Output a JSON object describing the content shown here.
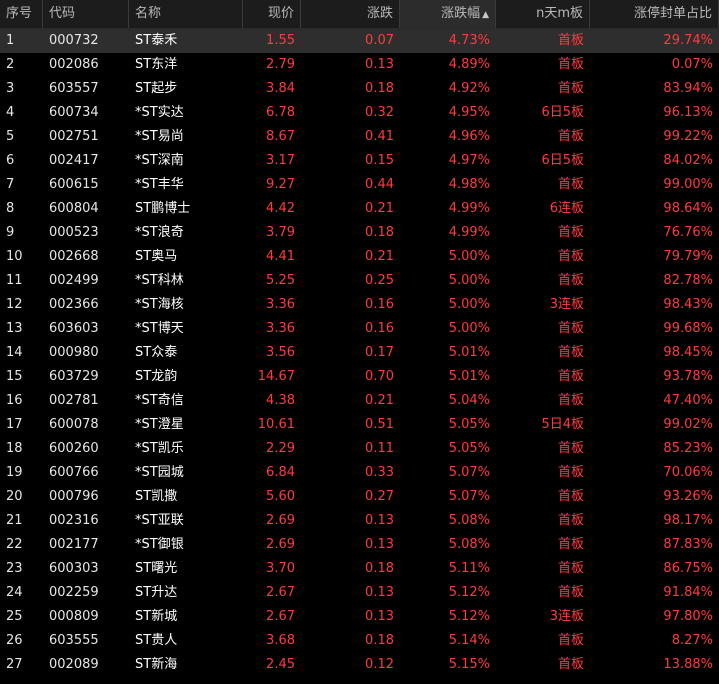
{
  "header": {
    "cols": [
      "序号",
      "代码",
      "名称",
      "现价",
      "涨跌",
      "涨跌幅",
      "n天m板",
      "涨停封单占比"
    ],
    "sort_indicator": "▲"
  },
  "colors": {
    "background": "#000000",
    "header_bg": "#1c1c1c",
    "selected_row_bg": "#2e2e2e",
    "up_red": "#ff3b3b",
    "text_white": "#e6e6e6"
  },
  "rows": [
    {
      "idx": "1",
      "code": "000732",
      "name": "ST泰禾",
      "price": "1.55",
      "change": "0.07",
      "pct": "4.73%",
      "board": "首板",
      "ratio": "29.74%"
    },
    {
      "idx": "2",
      "code": "002086",
      "name": "ST东洋",
      "price": "2.79",
      "change": "0.13",
      "pct": "4.89%",
      "board": "首板",
      "ratio": "0.07%"
    },
    {
      "idx": "3",
      "code": "603557",
      "name": "ST起步",
      "price": "3.84",
      "change": "0.18",
      "pct": "4.92%",
      "board": "首板",
      "ratio": "83.94%"
    },
    {
      "idx": "4",
      "code": "600734",
      "name": "*ST实达",
      "price": "6.78",
      "change": "0.32",
      "pct": "4.95%",
      "board": "6日5板",
      "ratio": "96.13%"
    },
    {
      "idx": "5",
      "code": "002751",
      "name": "*ST易尚",
      "price": "8.67",
      "change": "0.41",
      "pct": "4.96%",
      "board": "首板",
      "ratio": "99.22%"
    },
    {
      "idx": "6",
      "code": "002417",
      "name": "*ST深南",
      "price": "3.17",
      "change": "0.15",
      "pct": "4.97%",
      "board": "6日5板",
      "ratio": "84.02%"
    },
    {
      "idx": "7",
      "code": "600615",
      "name": "*ST丰华",
      "price": "9.27",
      "change": "0.44",
      "pct": "4.98%",
      "board": "首板",
      "ratio": "99.00%"
    },
    {
      "idx": "8",
      "code": "600804",
      "name": "ST鹏博士",
      "price": "4.42",
      "change": "0.21",
      "pct": "4.99%",
      "board": "6连板",
      "ratio": "98.64%"
    },
    {
      "idx": "9",
      "code": "000523",
      "name": "*ST浪奇",
      "price": "3.79",
      "change": "0.18",
      "pct": "4.99%",
      "board": "首板",
      "ratio": "76.76%"
    },
    {
      "idx": "10",
      "code": "002668",
      "name": "ST奥马",
      "price": "4.41",
      "change": "0.21",
      "pct": "5.00%",
      "board": "首板",
      "ratio": "79.79%"
    },
    {
      "idx": "11",
      "code": "002499",
      "name": "*ST科林",
      "price": "5.25",
      "change": "0.25",
      "pct": "5.00%",
      "board": "首板",
      "ratio": "82.78%"
    },
    {
      "idx": "12",
      "code": "002366",
      "name": "*ST海核",
      "price": "3.36",
      "change": "0.16",
      "pct": "5.00%",
      "board": "3连板",
      "ratio": "98.43%"
    },
    {
      "idx": "13",
      "code": "603603",
      "name": "*ST博天",
      "price": "3.36",
      "change": "0.16",
      "pct": "5.00%",
      "board": "首板",
      "ratio": "99.68%"
    },
    {
      "idx": "14",
      "code": "000980",
      "name": "ST众泰",
      "price": "3.56",
      "change": "0.17",
      "pct": "5.01%",
      "board": "首板",
      "ratio": "98.45%"
    },
    {
      "idx": "15",
      "code": "603729",
      "name": "ST龙韵",
      "price": "14.67",
      "change": "0.70",
      "pct": "5.01%",
      "board": "首板",
      "ratio": "93.78%"
    },
    {
      "idx": "16",
      "code": "002781",
      "name": "*ST奇信",
      "price": "4.38",
      "change": "0.21",
      "pct": "5.04%",
      "board": "首板",
      "ratio": "47.40%"
    },
    {
      "idx": "17",
      "code": "600078",
      "name": "*ST澄星",
      "price": "10.61",
      "change": "0.51",
      "pct": "5.05%",
      "board": "5日4板",
      "ratio": "99.02%"
    },
    {
      "idx": "18",
      "code": "600260",
      "name": "*ST凯乐",
      "price": "2.29",
      "change": "0.11",
      "pct": "5.05%",
      "board": "首板",
      "ratio": "85.23%"
    },
    {
      "idx": "19",
      "code": "600766",
      "name": "*ST园城",
      "price": "6.84",
      "change": "0.33",
      "pct": "5.07%",
      "board": "首板",
      "ratio": "70.06%"
    },
    {
      "idx": "20",
      "code": "000796",
      "name": "ST凯撒",
      "price": "5.60",
      "change": "0.27",
      "pct": "5.07%",
      "board": "首板",
      "ratio": "93.26%"
    },
    {
      "idx": "21",
      "code": "002316",
      "name": "*ST亚联",
      "price": "2.69",
      "change": "0.13",
      "pct": "5.08%",
      "board": "首板",
      "ratio": "98.17%"
    },
    {
      "idx": "22",
      "code": "002177",
      "name": "*ST御银",
      "price": "2.69",
      "change": "0.13",
      "pct": "5.08%",
      "board": "首板",
      "ratio": "87.83%"
    },
    {
      "idx": "23",
      "code": "600303",
      "name": "ST曙光",
      "price": "3.70",
      "change": "0.18",
      "pct": "5.11%",
      "board": "首板",
      "ratio": "86.75%"
    },
    {
      "idx": "24",
      "code": "002259",
      "name": "ST升达",
      "price": "2.67",
      "change": "0.13",
      "pct": "5.12%",
      "board": "首板",
      "ratio": "91.84%"
    },
    {
      "idx": "25",
      "code": "000809",
      "name": "ST新城",
      "price": "2.67",
      "change": "0.13",
      "pct": "5.12%",
      "board": "3连板",
      "ratio": "97.80%"
    },
    {
      "idx": "26",
      "code": "603555",
      "name": "ST贵人",
      "price": "3.68",
      "change": "0.18",
      "pct": "5.14%",
      "board": "首板",
      "ratio": "8.27%"
    },
    {
      "idx": "27",
      "code": "002089",
      "name": "ST新海",
      "price": "2.45",
      "change": "0.12",
      "pct": "5.15%",
      "board": "首板",
      "ratio": "13.88%"
    }
  ]
}
